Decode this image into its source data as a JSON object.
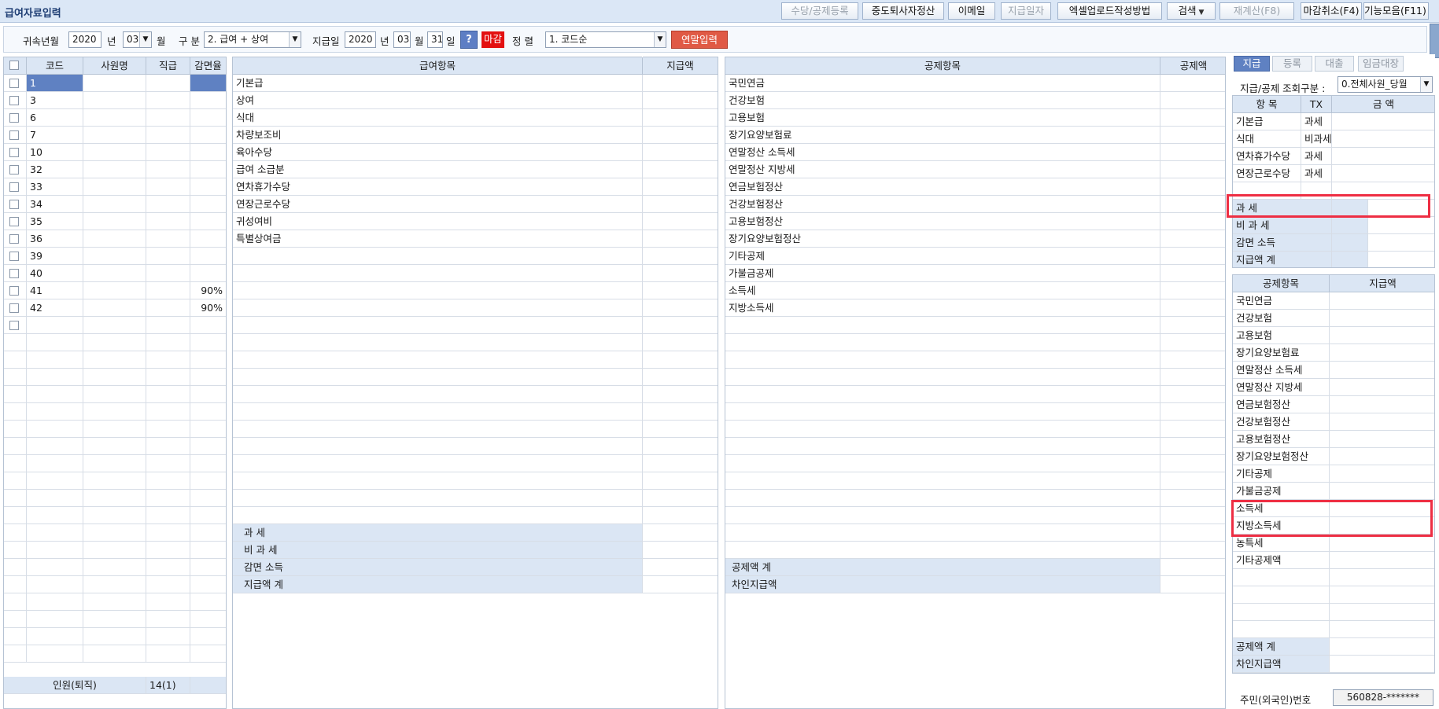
{
  "window": {
    "title": "급여자료입력"
  },
  "toolbar": [
    {
      "label": "수당/공제등록",
      "enabled": false,
      "dropdown": false
    },
    {
      "label": "중도퇴사자정산",
      "enabled": true,
      "dropdown": false
    },
    {
      "label": "이메일",
      "enabled": true,
      "dropdown": false
    },
    {
      "label": "지급일자",
      "enabled": false,
      "dropdown": false
    },
    {
      "label": "엑셀업로드작성방법",
      "enabled": true,
      "dropdown": false
    },
    {
      "label": "검색",
      "enabled": true,
      "dropdown": true
    },
    {
      "label": "재계산(F8)",
      "enabled": false,
      "dropdown": false
    },
    {
      "label": "마감취소(F4)",
      "enabled": true,
      "dropdown": false
    },
    {
      "label": "기능모음(F11)",
      "enabled": true,
      "dropdown": true
    }
  ],
  "filters": {
    "period_label": "귀속년월",
    "period_year": "2020",
    "year_unit": "년",
    "period_month": "03",
    "month_unit": "월",
    "type_label": "구 분",
    "type_value": "2. 급여 + 상여",
    "paydate_label": "지급일",
    "pay_year": "2020",
    "pay_year_unit": "년",
    "pay_month": "03",
    "pay_month_unit": "월",
    "pay_day": "31",
    "pay_day_unit": "일",
    "help": "?",
    "closed_badge": "마감",
    "sort_label": "정 렬",
    "sort_value": "1. 코드순",
    "yearend_button": "연말입력"
  },
  "employees": {
    "headers": [
      "코드",
      "사원명",
      "직급",
      "감면율"
    ],
    "rows": [
      {
        "code": "1",
        "name": "",
        "rank": "",
        "rate": ""
      },
      {
        "code": "3",
        "name": "",
        "rank": "",
        "rate": ""
      },
      {
        "code": "6",
        "name": "",
        "rank": "",
        "rate": ""
      },
      {
        "code": "7",
        "name": "",
        "rank": "",
        "rate": ""
      },
      {
        "code": "10",
        "name": "",
        "rank": "",
        "rate": ""
      },
      {
        "code": "32",
        "name": "",
        "rank": "",
        "rate": ""
      },
      {
        "code": "33",
        "name": "",
        "rank": "",
        "rate": ""
      },
      {
        "code": "34",
        "name": "",
        "rank": "",
        "rate": ""
      },
      {
        "code": "35",
        "name": "",
        "rank": "",
        "rate": ""
      },
      {
        "code": "36",
        "name": "",
        "rank": "",
        "rate": ""
      },
      {
        "code": "39",
        "name": "",
        "rank": "",
        "rate": ""
      },
      {
        "code": "40",
        "name": "",
        "rank": "",
        "rate": ""
      },
      {
        "code": "41",
        "name": "",
        "rank": "",
        "rate": "90%"
      },
      {
        "code": "42",
        "name": "",
        "rank": "",
        "rate": "90%"
      }
    ],
    "footer_label": "인원(퇴직)",
    "footer_count": "14(1)"
  },
  "pay_items": {
    "headers": [
      "급여항목",
      "지급액"
    ],
    "items": [
      "기본급",
      "상여",
      "식대",
      "차량보조비",
      "육아수당",
      "급여 소급분",
      "연차휴가수당",
      "연장근로수당",
      "귀성여비",
      "특별상여금"
    ],
    "totals": [
      "과 세",
      "비 과 세",
      "감면 소득",
      "지급액 계"
    ]
  },
  "deduct_items": {
    "headers": [
      "공제항목",
      "공제액"
    ],
    "items": [
      "국민연금",
      "건강보험",
      "고용보험",
      "장기요양보험료",
      "연말정산 소득세",
      "연말정산 지방세",
      "연금보험정산",
      "건강보험정산",
      "고용보험정산",
      "장기요양보험정산",
      "기타공제",
      "가불금공제",
      "소득세",
      "지방소득세"
    ],
    "totals": [
      "공제액 계",
      "차인지급액"
    ]
  },
  "right_panel": {
    "tabs": [
      "지급",
      "등록",
      "대출",
      "임금대장"
    ],
    "query_label": "지급/공제 조회구분 :",
    "query_value": "0.전체사원_당월",
    "pay_headers": [
      "항 목",
      "TX",
      "금 액"
    ],
    "pay_rows": [
      {
        "item": "기본급",
        "tx": "과세"
      },
      {
        "item": "식대",
        "tx": "비과세"
      },
      {
        "item": "연차휴가수당",
        "tx": "과세"
      },
      {
        "item": "연장근로수당",
        "tx": "과세"
      }
    ],
    "pay_totals": [
      "과 세",
      "비 과 세",
      "감면 소득",
      "지급액 계"
    ],
    "deduct_headers": [
      "공제항목",
      "지급액"
    ],
    "deduct_rows": [
      "국민연금",
      "건강보험",
      "고용보험",
      "장기요양보험료",
      "연말정산 소득세",
      "연말정산 지방세",
      "연금보험정산",
      "건강보험정산",
      "고용보험정산",
      "장기요양보험정산",
      "기타공제",
      "가불금공제",
      "소득세",
      "지방소득세",
      "농특세",
      "기타공제액"
    ],
    "deduct_totals": [
      "공제액 계",
      "차인지급액"
    ],
    "rrn_label": "주민(외국인)번호",
    "rrn_value": "560828-*******"
  },
  "colors": {
    "header_bg": "#dbe6f4",
    "selection": "#5f81c2",
    "highlight_box": "#ee2e43",
    "closed_badge": "#e31010",
    "yearend_button": "#e05a45"
  }
}
